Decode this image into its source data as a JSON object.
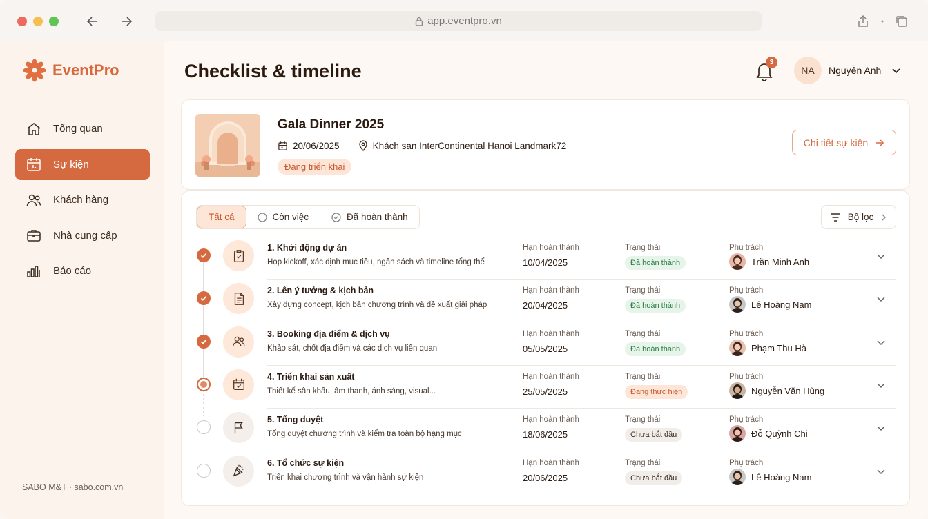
{
  "browser": {
    "url": "app.eventpro.vn"
  },
  "brand": {
    "name": "EventPro"
  },
  "sidebar": {
    "items": [
      {
        "label": "Tổng quan",
        "icon": "home-icon"
      },
      {
        "label": "Sự kiện",
        "icon": "calendar-icon",
        "active": true
      },
      {
        "label": "Khách hàng",
        "icon": "users-icon"
      },
      {
        "label": "Nhà cung cấp",
        "icon": "briefcase-icon"
      },
      {
        "label": "Báo cáo",
        "icon": "bar-chart-icon"
      }
    ],
    "footer": "SABO M&T · sabo.com.vn"
  },
  "header": {
    "title": "Checklist & timeline",
    "notifications": "3",
    "user_initials": "NA",
    "user_name": "Nguyễn Anh"
  },
  "event": {
    "title": "Gala Dinner 2025",
    "date": "20/06/2025",
    "location": "Khách sạn InterContinental Hanoi Landmark72",
    "status": "Đang triển khai",
    "detail_button": "Chi tiết sự kiện"
  },
  "filters": {
    "tabs": [
      "Tất cả",
      "Còn việc",
      "Đã hoàn thành"
    ],
    "filter_button": "Bộ lọc"
  },
  "labels": {
    "due": "Hạn hoàn thành",
    "status": "Trạng thái",
    "owner": "Phụ trách"
  },
  "tasks": [
    {
      "title": "1. Khởi động dự án",
      "desc": "Họp kickoff, xác định mục tiêu, ngân sách và timeline tổng thể",
      "due": "10/04/2025",
      "status": "Đã hoàn thành",
      "state": "done",
      "owner": "Trần Minh Anh",
      "icon": "clipboard-check-icon"
    },
    {
      "title": "2. Lên ý tưởng & kịch bản",
      "desc": "Xây dựng concept, kịch bản chương trình và đề xuất giải pháp",
      "due": "20/04/2025",
      "status": "Đã hoàn thành",
      "state": "done",
      "owner": "Lê Hoàng Nam",
      "icon": "document-icon"
    },
    {
      "title": "3. Booking địa điểm & dịch vụ",
      "desc": "Khảo sát, chốt địa điểm và các dịch vụ liên quan",
      "due": "05/05/2025",
      "status": "Đã hoàn thành",
      "state": "done",
      "owner": "Phạm Thu Hà",
      "icon": "users-icon"
    },
    {
      "title": "4. Triển khai sản xuất",
      "desc": "Thiết kế sân khấu, âm thanh, ánh sáng, visual...",
      "due": "25/05/2025",
      "status": "Đang thực hiện",
      "state": "progress",
      "owner": "Nguyễn Văn Hùng",
      "icon": "calendar-check-icon"
    },
    {
      "title": "5. Tổng duyệt",
      "desc": "Tổng duyệt chương trình và kiểm tra toàn bộ hạng mục",
      "due": "18/06/2025",
      "status": "Chưa bắt đầu",
      "state": "todo",
      "owner": "Đỗ Quỳnh Chi",
      "icon": "flag-icon"
    },
    {
      "title": "6. Tổ chức sự kiện",
      "desc": "Triển khai chương trình và vận hành sự kiện",
      "due": "20/06/2025",
      "status": "Chưa bắt đầu",
      "state": "todo",
      "owner": "Lê Hoàng Nam",
      "icon": "party-popper-icon"
    }
  ]
}
